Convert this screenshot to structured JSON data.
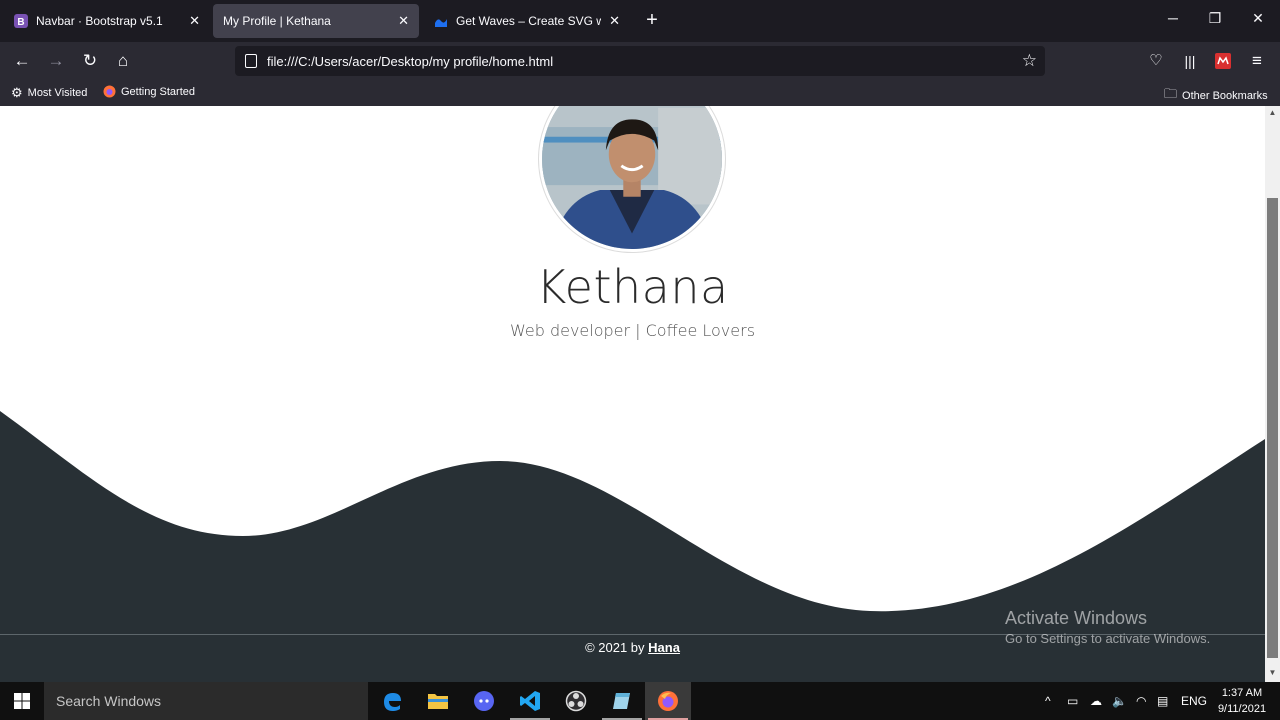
{
  "tabs": [
    {
      "title": "Navbar · Bootstrap v5.1",
      "favicon": "bootstrap-icon",
      "active": false
    },
    {
      "title": "My Profile | Kethana",
      "favicon": "none",
      "active": true
    },
    {
      "title": "Get Waves – Create SVG waves f",
      "favicon": "getwaves-icon",
      "active": false
    }
  ],
  "toolbar": {
    "url": "file:///C:/Users/acer/Desktop/my profile/home.html"
  },
  "bookmarks": {
    "most_visited": "Most Visited",
    "getting_started": "Getting Started",
    "other": "Other Bookmarks"
  },
  "profile": {
    "name": "Kethana",
    "subtitle": "Web developer | Coffee Lovers"
  },
  "footer": {
    "prefix": "© 2021 by ",
    "author": "Hana"
  },
  "watermark": {
    "line1": "Activate Windows",
    "line2": "Go to Settings to activate Windows."
  },
  "taskbar": {
    "search_placeholder": "Search Windows",
    "lang": "ENG",
    "time": "1:37 AM",
    "date": "9/11/2021"
  },
  "colors": {
    "wave": "#283035",
    "page_bg": "#ffffff",
    "tab_active": "#42414d"
  }
}
